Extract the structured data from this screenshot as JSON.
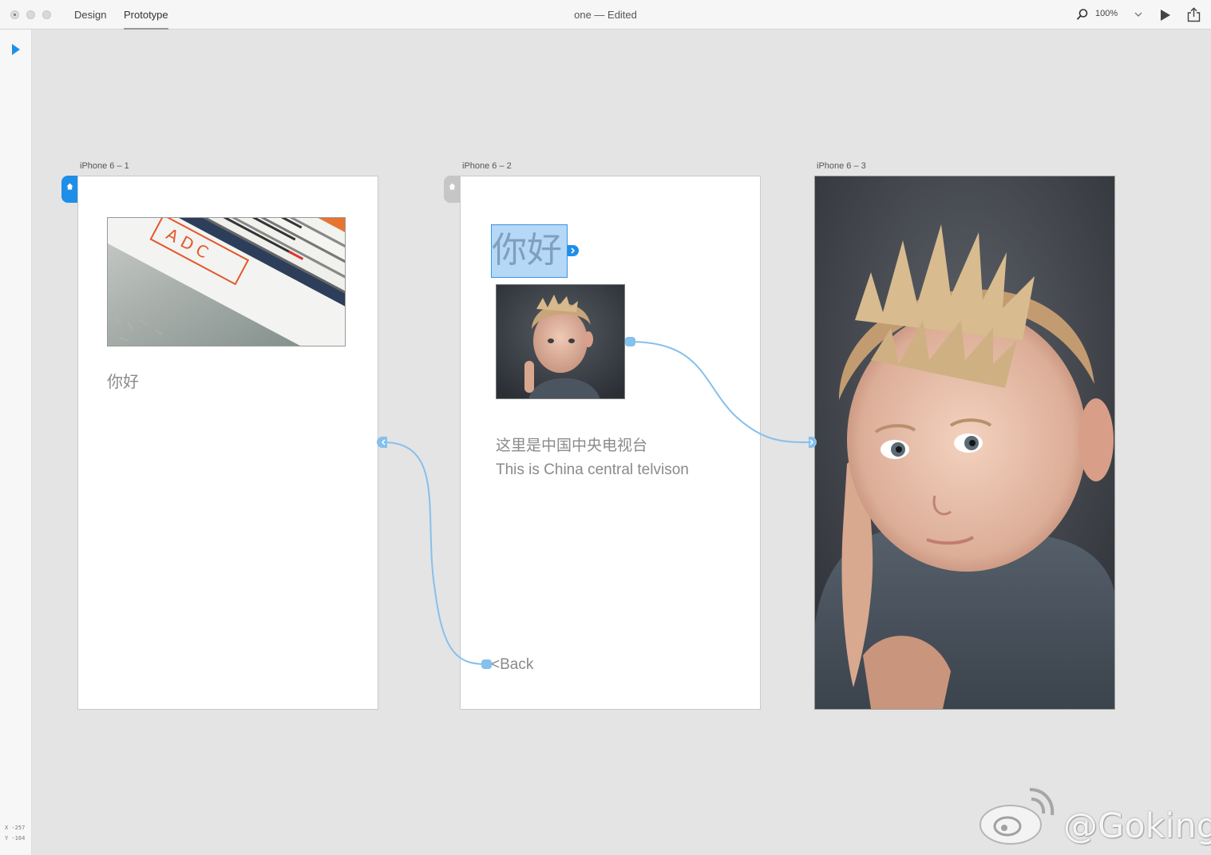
{
  "window": {
    "tabs": [
      {
        "label": "Design"
      },
      {
        "label": "Prototype"
      }
    ],
    "active_tab": "Prototype",
    "title": "one — Edited",
    "zoom": "100%"
  },
  "canvas": {
    "coords": {
      "x": "X  -257",
      "y": "Y  -164"
    },
    "artboards": [
      {
        "label": "iPhone 6 – 1",
        "home": true,
        "texts": {
          "greeting": "你好"
        },
        "image": "stack-of-books-photo"
      },
      {
        "label": "iPhone 6 – 2",
        "home": false,
        "texts": {
          "greeting": "你好",
          "line_cn": "这里是中国中央电视台",
          "line_en": "This is China central telvison",
          "back": "<Back"
        },
        "image": "boy-portrait-thumbnail"
      },
      {
        "label": "iPhone 6 – 3",
        "home": false,
        "image": "boy-portrait-full"
      }
    ]
  },
  "watermark": {
    "text": "@Goking"
  },
  "colors": {
    "accent": "#1e8fe8",
    "wire": "#86c0ec",
    "canvas_bg": "#e4e4e4"
  }
}
